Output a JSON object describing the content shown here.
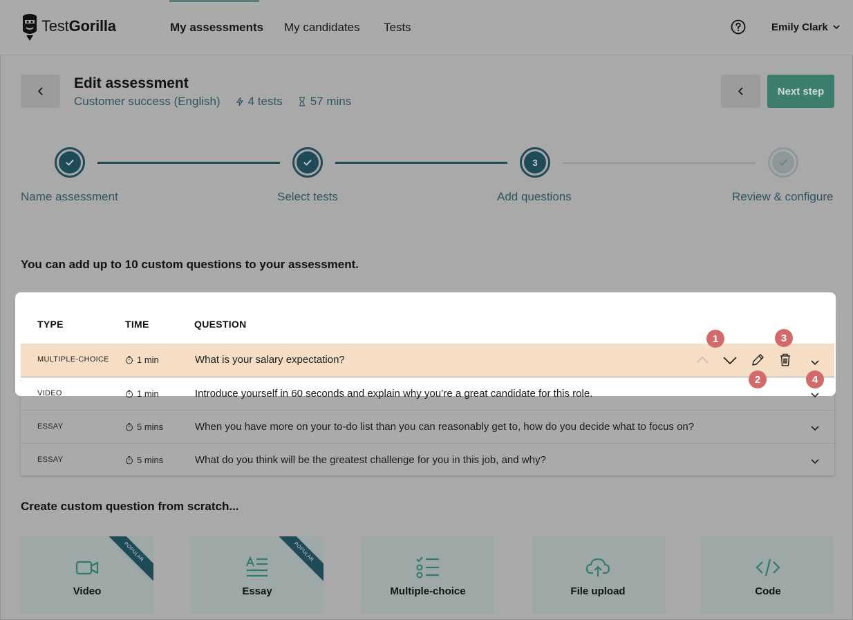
{
  "brand": {
    "name_light": "Test",
    "name_bold": "Gorilla"
  },
  "nav": {
    "items": [
      {
        "label": "My assessments",
        "active": true
      },
      {
        "label": "My candidates",
        "active": false
      },
      {
        "label": "Tests",
        "active": false
      }
    ],
    "user": "Emily Clark"
  },
  "header": {
    "title": "Edit assessment",
    "assessment_name": "Customer success (English)",
    "tests_count": "4 tests",
    "duration": "57 mins",
    "next_label": "Next step"
  },
  "stepper": {
    "steps": [
      {
        "label": "Name assessment",
        "state": "done"
      },
      {
        "label": "Select tests",
        "state": "done"
      },
      {
        "label": "Add questions",
        "state": "current",
        "number": "3"
      },
      {
        "label": "Review & configure",
        "state": "pending"
      }
    ]
  },
  "intro": "You can add up to 10 custom questions to your assessment.",
  "table": {
    "headers": {
      "type": "TYPE",
      "time": "TIME",
      "question": "QUESTION"
    },
    "rows": [
      {
        "type": "MULTIPLE-CHOICE",
        "time": "1 min",
        "question": "What is your salary expectation?"
      },
      {
        "type": "VIDEO",
        "time": "1 min",
        "question": "Introduce yourself in 60 seconds and explain why you’re a great candidate for this role."
      },
      {
        "type": "ESSAY",
        "time": "5 mins",
        "question": "When you have more on your to-do list than you can reasonably get to, how do you decide what to focus on?"
      },
      {
        "type": "ESSAY",
        "time": "5 mins",
        "question": "What do you think will be the greatest challenge for you in this job, and why?"
      }
    ],
    "badges": [
      "1",
      "2",
      "3",
      "4"
    ]
  },
  "create": {
    "title": "Create custom question from scratch...",
    "cards": [
      {
        "label": "Video",
        "ribbon": "POPULAR"
      },
      {
        "label": "Essay",
        "ribbon": "POPULAR"
      },
      {
        "label": "Multiple-choice"
      },
      {
        "label": "File upload"
      },
      {
        "label": "Code"
      }
    ]
  },
  "colors": {
    "teal_dark": "#1f4a58",
    "accent_green": "#3c7d6e",
    "highlight_row": "#f6dec6",
    "badge": "#d26a6a"
  }
}
